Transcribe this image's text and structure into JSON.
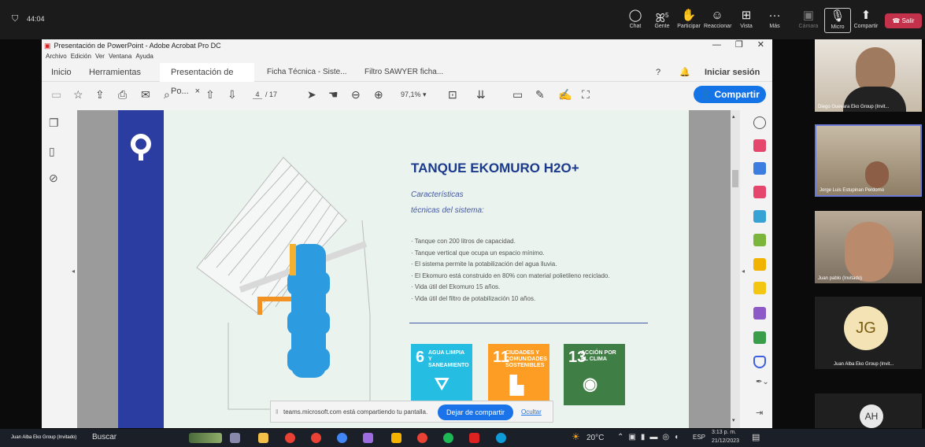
{
  "teams": {
    "timer": "44:04",
    "buttons": [
      {
        "icon": "chat-icon",
        "label": "Chat"
      },
      {
        "icon": "people-icon",
        "label": "Gente",
        "badge": "5"
      },
      {
        "icon": "raise-hand-icon",
        "label": "Participar"
      },
      {
        "icon": "react-icon",
        "label": "Reaccionar"
      },
      {
        "icon": "view-icon",
        "label": "Vista"
      },
      {
        "icon": "more-icon",
        "label": "Más"
      },
      {
        "icon": "camera-off-icon",
        "label": "Cámara"
      },
      {
        "icon": "mic-icon",
        "label": "Micro"
      },
      {
        "icon": "share-icon",
        "label": "Compartir"
      }
    ],
    "leave_label": "Salir",
    "share_notice": "teams.microsoft.com está compartiendo tu pantalla.",
    "stop_share_label": "Dejar de compartir",
    "hide_label": "Ocultar"
  },
  "participants": [
    {
      "name": "Diego Guevara Eko Group (Invit...",
      "bg": "#cfc6b8"
    },
    {
      "name": "Jorge Luis Estupinan Perdomo",
      "bg": "#b9aa92"
    },
    {
      "name": "Juan pablo (Invitado)",
      "bg": "#a89a88"
    },
    {
      "name": "Juan Alba Eko Group (Invit...",
      "initials": "JG",
      "bg": "#f3e3b5"
    },
    {
      "initials": "AH",
      "bg": "#e8e8e8"
    }
  ],
  "acrobat": {
    "title": "Presentación de PowerPoint - Adobe Acrobat Pro DC",
    "menu": [
      "Archivo",
      "Edición",
      "Ver",
      "Ventana",
      "Ayuda"
    ],
    "tabs": [
      "Inicio",
      "Herramientas",
      "Presentación de Po...",
      "Ficha Técnica - Siste...",
      "Filtro SAWYER ficha..."
    ],
    "signin": "Iniciar sesión",
    "share_btn": "Compartir",
    "page_current": "4",
    "page_total": "/ 17",
    "zoom": "97,1%"
  },
  "slide": {
    "title": "TANQUE EKOMURO H2O+",
    "subtitle_1": "Características",
    "subtitle_2": "técnicas del sistema:",
    "bullets": [
      "· Tanque con 200 litros de capacidad.",
      "· Tanque vertical que ocupa un espacio mínimo.",
      "· El sistema permite la potabilización del agua lluvia.",
      "· El Ekomuro está construido en 80% con material polietileno reciclado.",
      "· Vida útil del Ekomuro 15 años.",
      "· Vida útil del filtro de potabilización 10 años."
    ],
    "sdgs": [
      {
        "num": "6",
        "text": "AGUA LIMPIA Y SANEAMIENTO",
        "color": "#26bde2"
      },
      {
        "num": "11",
        "text": "CIUDADES Y COMUNIDADES SOSTENIBLES",
        "color": "#fd9d24"
      },
      {
        "num": "13",
        "text": "ACCIÓN POR EL CLIMA",
        "color": "#3f7e44"
      }
    ]
  },
  "taskbar": {
    "presenter": "Juan Alba Eko Group (Invitado)",
    "search": "Buscar",
    "temp": "20°C",
    "lang": "ESP",
    "time": "3:13 p. m.",
    "date": "21/12/2023"
  }
}
